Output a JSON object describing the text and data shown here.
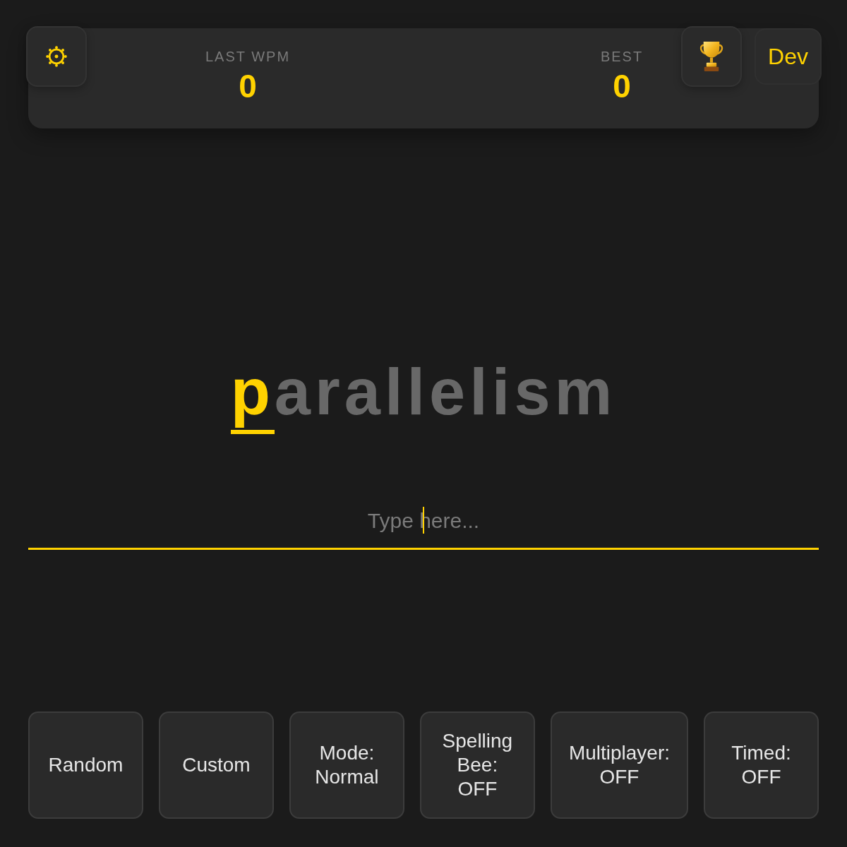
{
  "header": {
    "stats": [
      {
        "label": "LAST WPM",
        "value": "0"
      },
      {
        "label": "BEST",
        "value": "0"
      }
    ],
    "user_button": "Dev"
  },
  "word": {
    "parts": [
      {
        "text": "p",
        "current": true
      },
      {
        "text": "arallelism",
        "current": false
      }
    ]
  },
  "input": {
    "placeholder": "Type here...",
    "focused": true
  },
  "buttons": [
    {
      "label": "Random"
    },
    {
      "label": "Custom"
    },
    {
      "label": "Mode: Normal"
    },
    {
      "label": "Spelling Bee: OFF"
    },
    {
      "label": "Multiplayer: OFF"
    },
    {
      "label": "Timed: OFF"
    }
  ]
}
